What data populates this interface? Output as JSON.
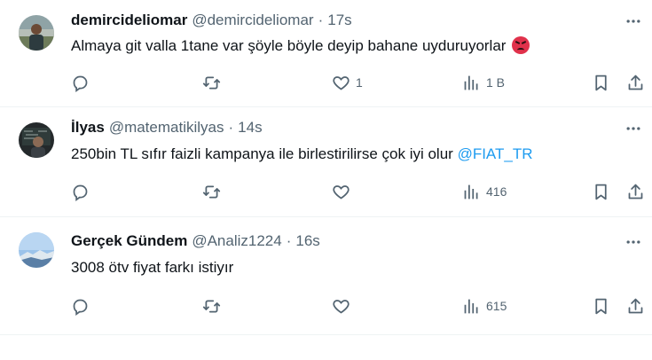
{
  "tweets": [
    {
      "name": "demircideliomar",
      "handle": "@demircideliomar",
      "time": "17s",
      "text": "Almaya git valla 1tane var şöyle böyle deyip bahane uyduruyorlar",
      "emoji": "angry-face",
      "mention": "",
      "counts": {
        "like": "1",
        "views": "1 B"
      }
    },
    {
      "name": "İlyas",
      "handle": "@matematikilyas",
      "time": "14s",
      "text": "250bin TL sıfır faizli kampanya ile birlestirilirse çok iyi olur",
      "mention": "@FIAT_TR",
      "counts": {
        "like": "",
        "views": "416"
      }
    },
    {
      "name": "Gerçek Gündem",
      "handle": "@Analiz1224",
      "time": "16s",
      "text": "3008 ötv fiyat farkı istiyır",
      "mention": "",
      "counts": {
        "like": "",
        "views": "615"
      }
    }
  ],
  "separator": "·",
  "icons": {
    "reply": "reply-icon",
    "retweet": "retweet-icon",
    "like": "heart-icon",
    "views": "views-chart-icon",
    "bookmark": "bookmark-icon",
    "share": "share-icon",
    "more": "more-icon"
  },
  "colors": {
    "text": "#0f1419",
    "muted": "#536471",
    "link": "#1d9bf0",
    "border": "#eff3f4"
  }
}
